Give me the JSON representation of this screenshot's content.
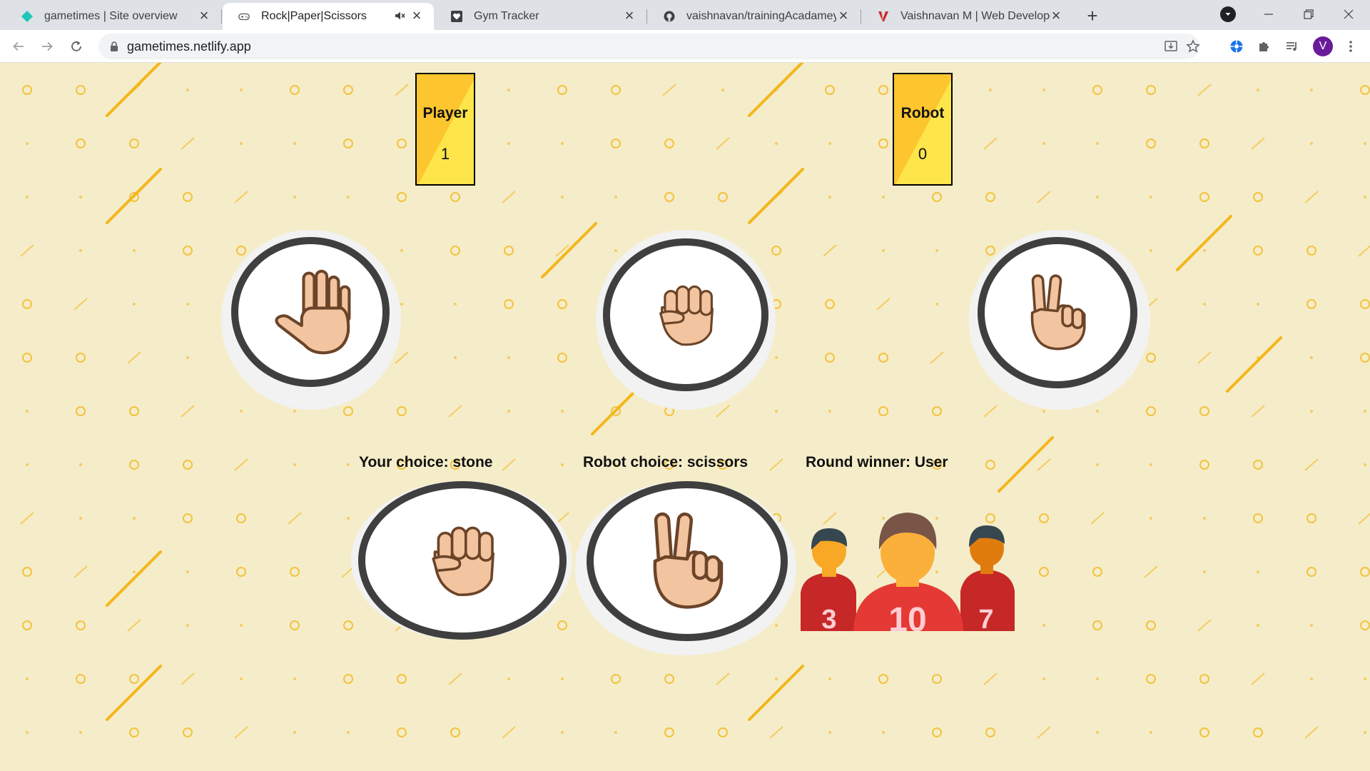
{
  "tabs": [
    {
      "title": "gametimes | Site overview",
      "icon": "netlify-diamond-icon",
      "active": false
    },
    {
      "title": "Rock|Paper|Scissors",
      "icon": "gamepad-icon",
      "active": true,
      "audio": "mute-icon"
    },
    {
      "title": "Gym Tracker",
      "icon": "heart-favicon-icon",
      "active": false
    },
    {
      "title": "vaishnavan/trainingAcadamey",
      "icon": "github-icon",
      "active": false
    },
    {
      "title": "Vaishnavan M | Web Developer",
      "icon": "v-logo-icon",
      "active": false
    }
  ],
  "toolbar": {
    "url": "gametimes.netlify.app",
    "profile_initial": "V"
  },
  "game": {
    "player_label": "Player",
    "player_score": "1",
    "robot_label": "Robot",
    "robot_score": "0",
    "choices": [
      "paper",
      "stone",
      "scissors"
    ],
    "your_choice_text": "Your choice: stone",
    "robot_choice_text": "Robot choice: scissors",
    "round_winner_text": "Round winner: User",
    "winner_badge_numbers": [
      "3",
      "10",
      "7"
    ]
  },
  "colors": {
    "page_bg": "#f5edc9",
    "pattern_accent": "#f4b61b",
    "scorecard_gold": "#fdc62e",
    "scorecard_yellow": "#fde54a",
    "ring": "#3f3f3f",
    "skin": "#f2c4a0",
    "skin_outline": "#6b4428"
  }
}
